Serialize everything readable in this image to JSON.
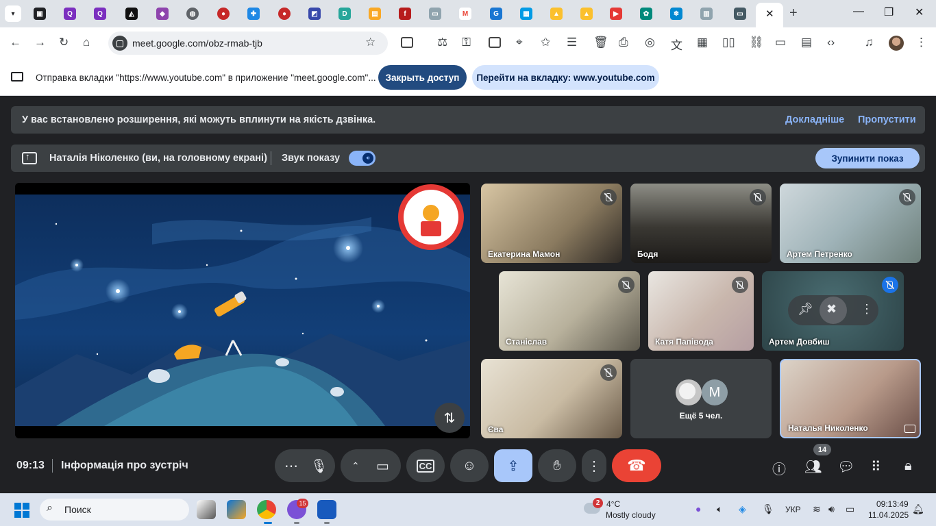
{
  "browser": {
    "url": "meet.google.com/obz-rmab-tjb",
    "close_tab_glyph": "✕",
    "new_tab_glyph": "+"
  },
  "share_bar": {
    "message": "Отправка вкладки \"https://www.youtube.com\" в приложение \"meet.google.com\"...",
    "stop_access_label": "Закрыть доступ",
    "goto_tab_label": "Перейти на вкладку: www.youtube.com"
  },
  "warning": {
    "text": "У вас встановлено розширення, які можуть вплинути на якість дзвінка.",
    "more_label": "Докладніше",
    "skip_label": "Пропустити"
  },
  "presenting": {
    "presenter_text": "Наталія Ніколенко (ви, на головному екрані)",
    "sound_label": "Звук показу",
    "sound_on": true,
    "stop_label": "Зупинити показ"
  },
  "participants": [
    {
      "name": "Екатерина Мамон",
      "muted": true
    },
    {
      "name": "Бодя",
      "muted": true
    },
    {
      "name": "Артем Петренко",
      "muted": true
    },
    {
      "name": "Станіслав",
      "muted": true
    },
    {
      "name": "Катя Папівода",
      "muted": true
    },
    {
      "name": "Артем Довбиш",
      "muted": true
    },
    {
      "name": "Єва",
      "muted": true
    },
    {
      "name": "Наталья Николенко",
      "muted": false
    }
  ],
  "more_people": {
    "avatar_letter": "M",
    "label": "Ещё 5 чел."
  },
  "bottom_bar": {
    "time": "09:13",
    "meeting_info": "Інформація про зустріч",
    "people_count": "14"
  },
  "taskbar": {
    "search_placeholder": "Поиск",
    "viber_badge": "15",
    "weather_badge": "2",
    "temperature": "4°C",
    "weather_desc": "Mostly cloudy",
    "language": "УКР",
    "clock_time": "09:13:49",
    "clock_date": "11.04.2025"
  },
  "colors": {
    "meet_bg": "#202124",
    "panel": "#3c4043",
    "accent_blue": "#8ab4f8",
    "end_call_red": "#ea4335",
    "share_button_dark": "#224b80"
  }
}
